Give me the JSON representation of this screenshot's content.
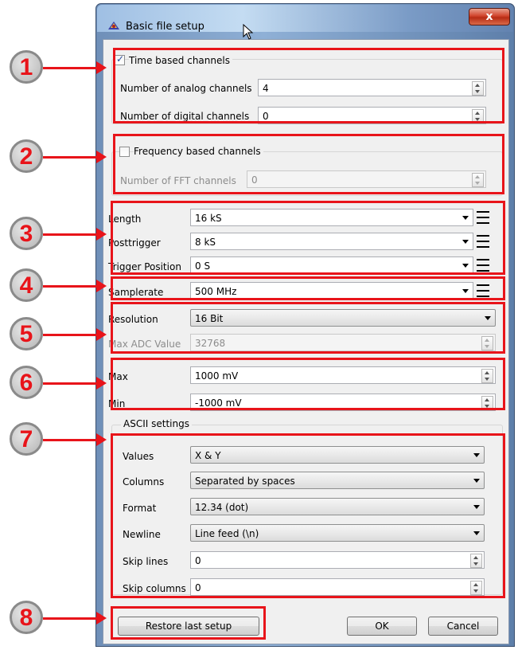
{
  "window": {
    "title": "Basic file setup",
    "close_label": "x"
  },
  "time_group": {
    "checkbox_label": "Time based channels",
    "checked": true,
    "analog_label": "Number of analog channels",
    "analog_value": "4",
    "digital_label": "Number of digital channels",
    "digital_value": "0"
  },
  "freq_group": {
    "checkbox_label": "Frequency based channels",
    "checked": false,
    "fft_label": "Number of FFT channels",
    "fft_value": "0"
  },
  "timing": {
    "length_label": "Length",
    "length_value": "16 kS",
    "posttrigger_label": "Posttrigger",
    "posttrigger_value": "8 kS",
    "trigger_label": "Trigger Position",
    "trigger_value": "0 S"
  },
  "samplerate": {
    "label": "Samplerate",
    "value": "500 MHz"
  },
  "resolution": {
    "label": "Resolution",
    "value": "16 Bit",
    "maxadc_label": "Max ADC Value",
    "maxadc_value": "32768"
  },
  "range": {
    "max_label": "Max",
    "max_value": "1000 mV",
    "min_label": "Min",
    "min_value": "-1000 mV"
  },
  "ascii": {
    "group_label": "ASCII settings",
    "values_label": "Values",
    "values_value": "X & Y",
    "columns_label": "Columns",
    "columns_value": "Separated by spaces",
    "format_label": "Format",
    "format_value": "12.34 (dot)",
    "newline_label": "Newline",
    "newline_value": "Line feed (\\n)",
    "skiplines_label": "Skip lines",
    "skiplines_value": "0",
    "skipcols_label": "Skip columns",
    "skipcols_value": "0"
  },
  "buttons": {
    "restore": "Restore last setup",
    "ok": "OK",
    "cancel": "Cancel"
  },
  "annotations": [
    "1",
    "2",
    "3",
    "4",
    "5",
    "6",
    "7",
    "8"
  ],
  "colors": {
    "annotation": "#e8141a",
    "badge": "#b5b5b5"
  }
}
